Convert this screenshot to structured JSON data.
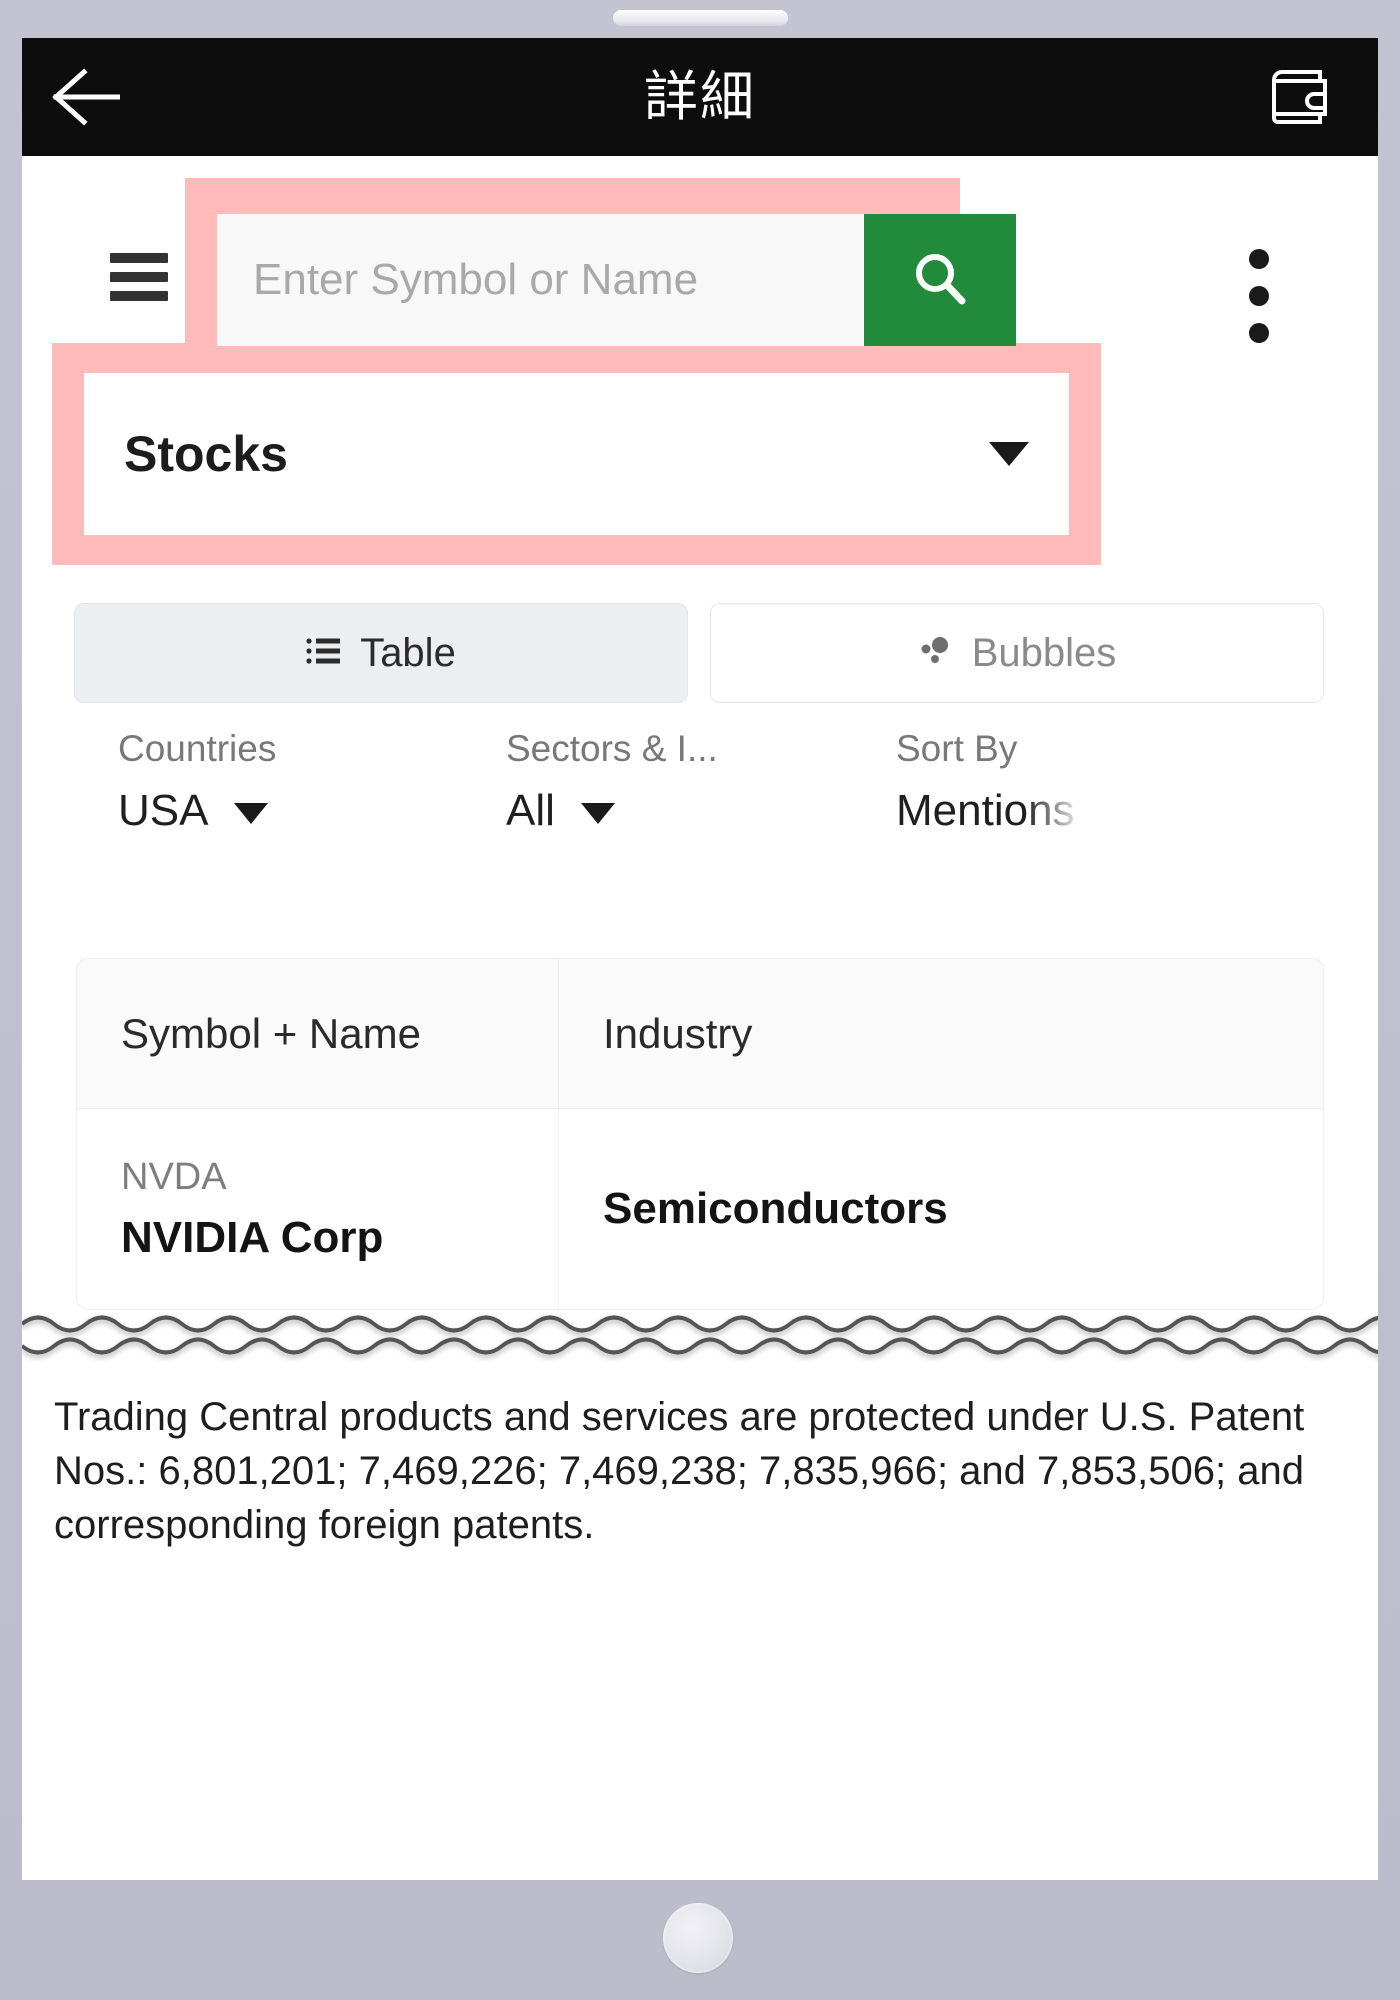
{
  "header": {
    "title": "詳細",
    "back_icon": "back-arrow-icon",
    "wallet_icon": "wallet-icon"
  },
  "search": {
    "menu_icon": "hamburger-menu-icon",
    "placeholder": "Enter Symbol or Name",
    "value": "",
    "search_icon": "search-icon",
    "search_button_color": "#228b3b",
    "overflow_icon": "kebab-menu-icon"
  },
  "asset_dropdown": {
    "label": "Stocks",
    "caret_icon": "chevron-down-icon",
    "highlight_color": "#ffbaba"
  },
  "view_toggle": {
    "tabs": [
      {
        "label": "Table",
        "icon": "list-icon",
        "active": true
      },
      {
        "label": "Bubbles",
        "icon": "bubbles-icon",
        "active": false
      }
    ]
  },
  "filters": [
    {
      "label": "Countries",
      "value": "USA",
      "caret_icon": "chevron-down-icon",
      "has_caret": true
    },
    {
      "label": "Sectors & I...",
      "value": "All",
      "caret_icon": "chevron-down-icon",
      "has_caret": true
    },
    {
      "label": "Sort By",
      "value": "Mentions",
      "caret_icon": "chevron-down-icon",
      "has_caret": false
    }
  ],
  "table": {
    "columns": [
      "Symbol + Name",
      "Industry"
    ],
    "rows": [
      {
        "ticker": "NVDA",
        "name": "NVIDIA Corp",
        "industry": "Semiconductors"
      }
    ]
  },
  "footer": {
    "disclaimer": "Trading Central products and services are protected under U.S. Patent Nos.: 6,801,201; 7,469,226; 7,469,238; 7,835,966; and 7,853,506; and corresponding foreign patents."
  }
}
